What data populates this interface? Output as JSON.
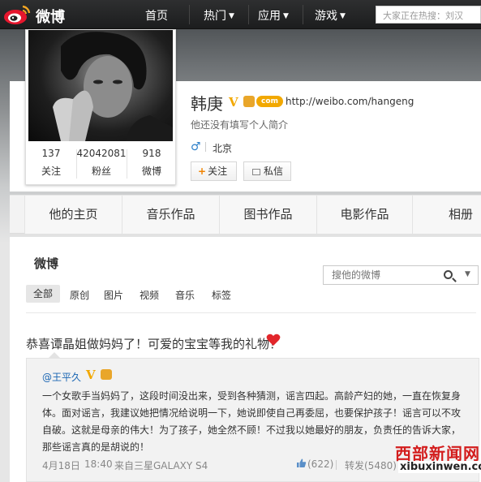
{
  "topnav": {
    "brand": "微博",
    "items": [
      {
        "label": "首页",
        "caret": ""
      },
      {
        "label": "热门",
        "caret": "▼"
      },
      {
        "label": "应用",
        "caret": "▼"
      },
      {
        "label": "游戏",
        "caret": "▼"
      }
    ],
    "search_text": "大家正在热搜：刘汉"
  },
  "profile": {
    "name": "韩庚",
    "verified_badge": "V",
    "member_badge": "com",
    "url": "http://weibo.com/hangeng",
    "bio": "他还没有填写个人简介",
    "gender_symbol": "♂",
    "location": "北京",
    "stats": [
      {
        "value": "137",
        "label": "关注"
      },
      {
        "value": "42042081",
        "label": "粉丝"
      },
      {
        "value": "918",
        "label": "微博"
      }
    ],
    "follow_plus": "+",
    "follow_label": "关注",
    "message_label": "私信"
  },
  "tabs": [
    "他的主页",
    "音乐作品",
    "图书作品",
    "电影作品",
    "相册"
  ],
  "weibo": {
    "title": "微博",
    "search_placeholder": "搜他的微博",
    "search_caret": "▼",
    "filters": [
      "全部",
      "原创",
      "图片",
      "视频",
      "音乐",
      "标签"
    ],
    "post_text": "恭喜谭晶姐做妈妈了！可爱的宝宝等我的礼物！",
    "repost": {
      "user": "@王平久",
      "verified_badge": "V",
      "body_lines": [
        "一个女歌手当妈妈了，这段时间没出来，受到各种猜测，谣言四起。高龄产妇的她，一直在恢复身",
        "体。面对谣言，我建议她把情况给说明一下，她说即使自己再委屈，也要保护孩子！谣言可以不攻",
        "自破。这就是母亲的伟大！为了孩子，她全然不顾！不过我以她最好的朋友，负责任的告诉大家，",
        "那些谣言真的是胡说的！"
      ],
      "date": "4月18日",
      "time": "18:40",
      "source": "来自三星GALAXY S4",
      "likes": "(622)",
      "reposts": "转发(5480)"
    }
  },
  "watermark": {
    "cn": "西部新闻网",
    "en": "xibuxinwen.com"
  }
}
